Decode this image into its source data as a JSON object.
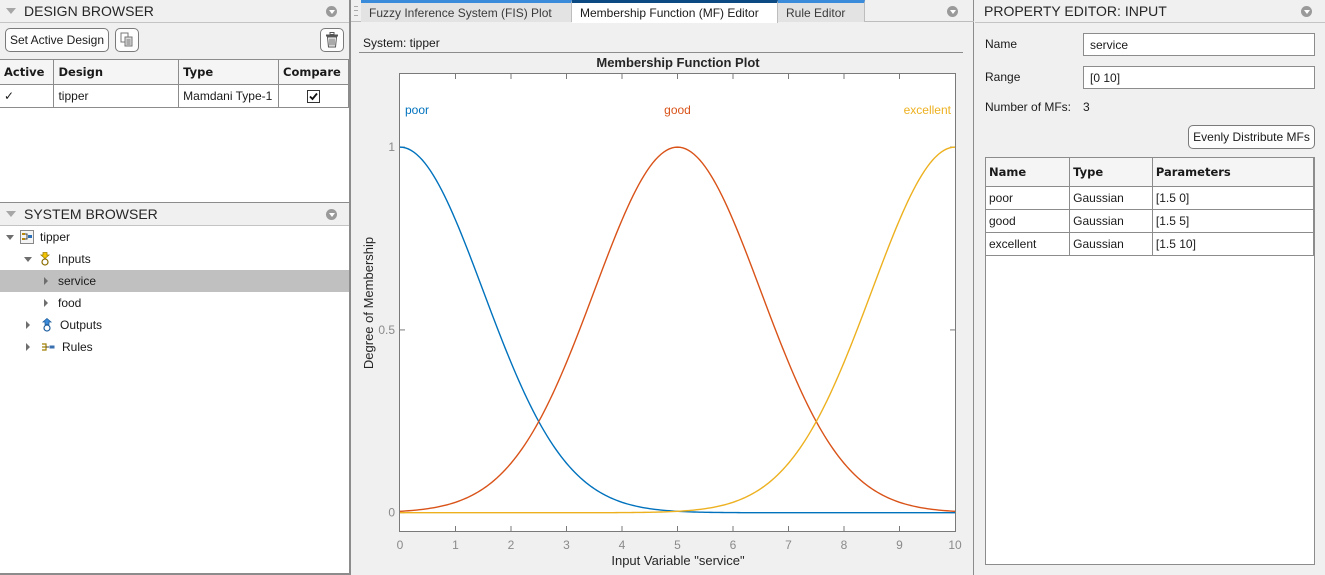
{
  "design_browser": {
    "title": "DESIGN BROWSER",
    "set_active_label": "Set Active Design",
    "columns": [
      "Active",
      "Design",
      "Type",
      "Compare"
    ],
    "rows": [
      {
        "active": "✓",
        "design": "tipper",
        "type": "Mamdani Type-1",
        "compare": true
      }
    ]
  },
  "system_browser": {
    "title": "SYSTEM BROWSER",
    "tree": [
      {
        "label": "tipper",
        "level": 0,
        "expanded": true,
        "icon": "fis-icon"
      },
      {
        "label": "Inputs",
        "level": 1,
        "expanded": true,
        "icon": "inputs-icon"
      },
      {
        "label": "service",
        "level": 2,
        "expanded": false,
        "selected": true
      },
      {
        "label": "food",
        "level": 2,
        "expanded": false
      },
      {
        "label": "Outputs",
        "level": 1,
        "expanded": false,
        "icon": "outputs-icon"
      },
      {
        "label": "Rules",
        "level": 1,
        "expanded": false,
        "icon": "rules-icon"
      }
    ]
  },
  "tabs": [
    {
      "label": "Fuzzy Inference System (FIS) Plot",
      "active": false
    },
    {
      "label": "Membership Function (MF) Editor",
      "active": true
    },
    {
      "label": "Rule Editor",
      "active": false
    }
  ],
  "system_label": "System: tipper",
  "chart_data": {
    "type": "line",
    "title": "Membership Function Plot",
    "xlabel": "Input Variable \"service\"",
    "ylabel": "Degree of Membership",
    "xlim": [
      0,
      10
    ],
    "ylim": [
      -0.05,
      1.2
    ],
    "xticks": [
      0,
      1,
      2,
      3,
      4,
      5,
      6,
      7,
      8,
      9,
      10
    ],
    "yticks": [
      0,
      0.5,
      1
    ],
    "ytick_labels": [
      "0",
      "0.5",
      "1"
    ],
    "grid": false,
    "series": [
      {
        "name": "poor",
        "function": "gaussmf",
        "sigma": 1.5,
        "center": 0,
        "color": "#0072BD"
      },
      {
        "name": "good",
        "function": "gaussmf",
        "sigma": 1.5,
        "center": 5,
        "color": "#D95319"
      },
      {
        "name": "excellent",
        "function": "gaussmf",
        "sigma": 1.5,
        "center": 10,
        "color": "#EDB120"
      }
    ]
  },
  "property_editor": {
    "title": "PROPERTY EDITOR: INPUT",
    "name_label": "Name",
    "name_value": "service",
    "range_label": "Range",
    "range_value": "[0 10]",
    "num_mfs_label": "Number of MFs:",
    "num_mfs_value": "3",
    "distribute_label": "Evenly Distribute MFs",
    "columns": [
      "Name",
      "Type",
      "Parameters"
    ],
    "rows": [
      {
        "name": "poor",
        "type": "Gaussian",
        "params": "[1.5 0]"
      },
      {
        "name": "good",
        "type": "Gaussian",
        "params": "[1.5 5]"
      },
      {
        "name": "excellent",
        "type": "Gaussian",
        "params": "[1.5 10]"
      }
    ]
  }
}
